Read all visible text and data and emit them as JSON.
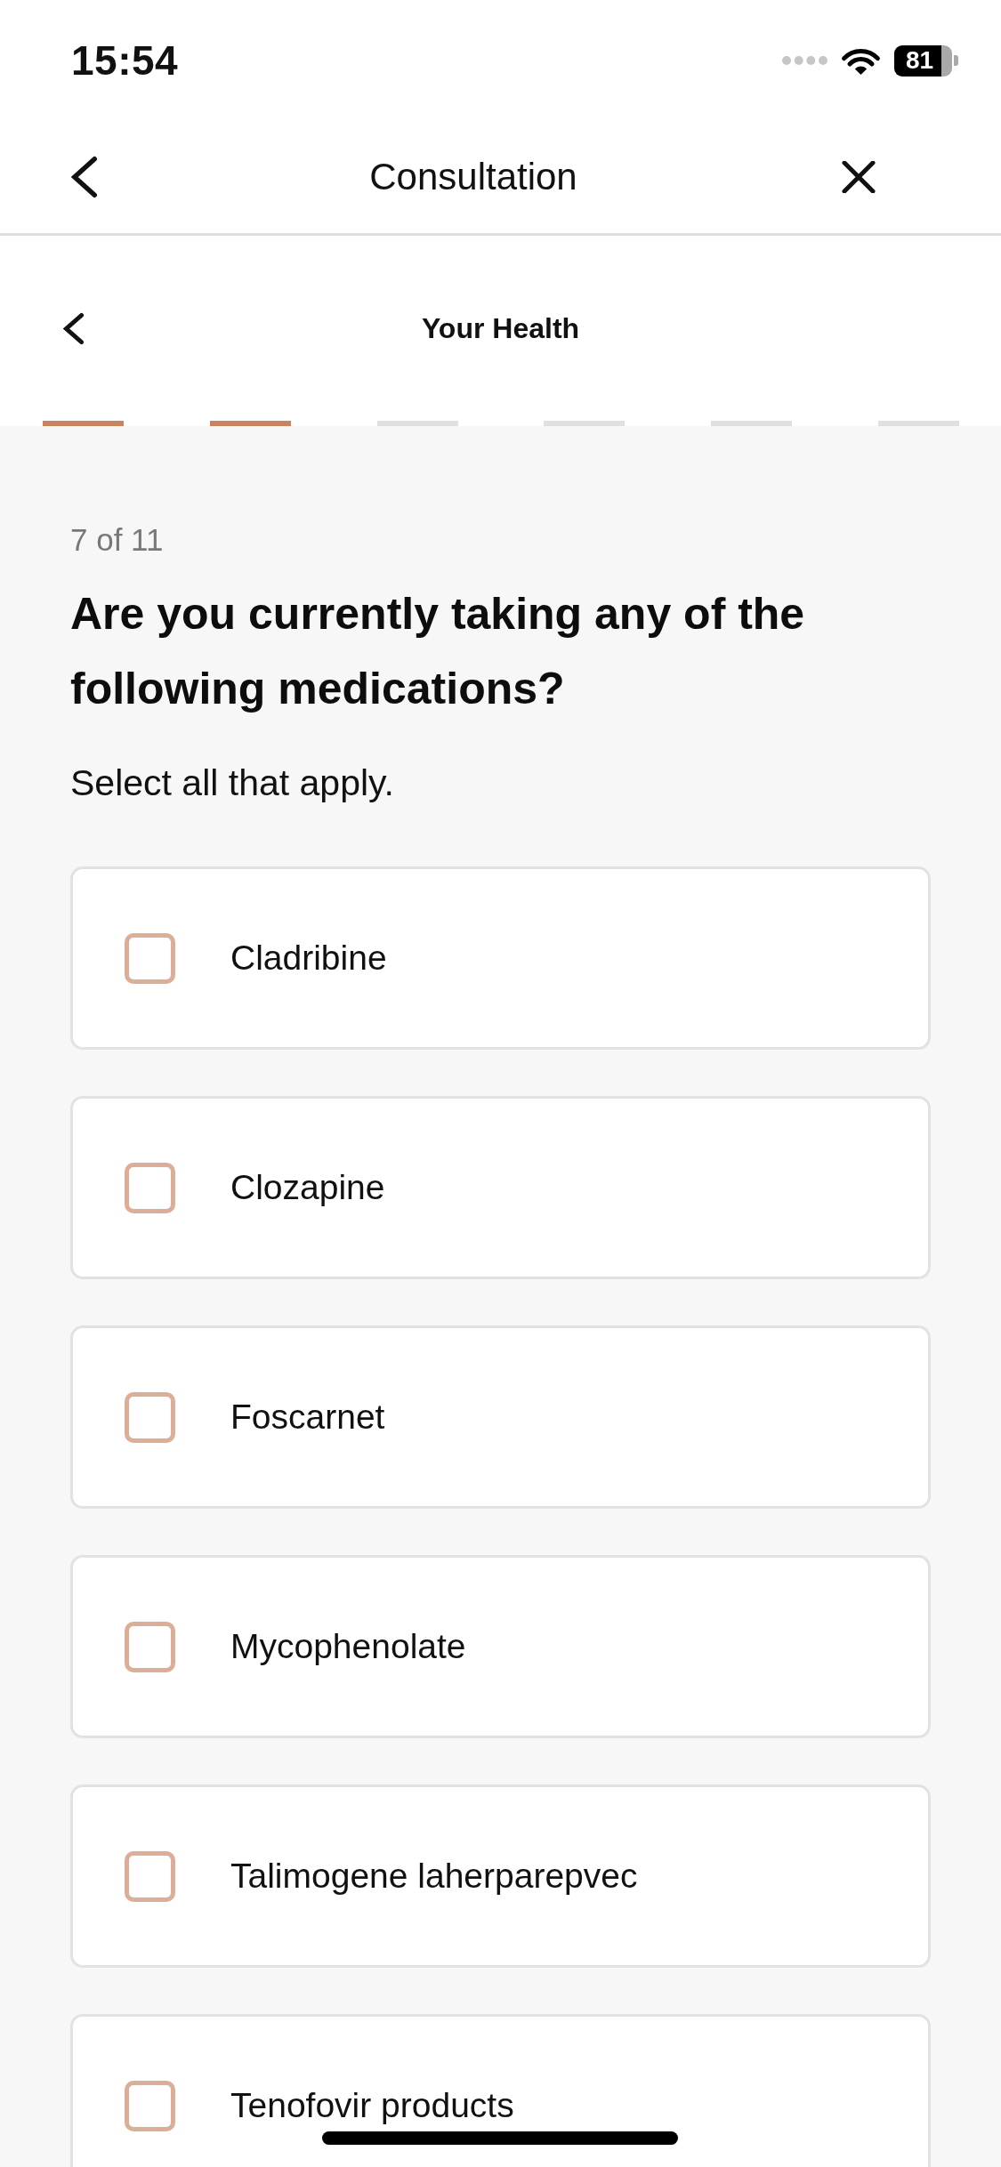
{
  "status_bar": {
    "time": "15:54",
    "battery": "81"
  },
  "nav_bar": {
    "title": "Consultation"
  },
  "section_header": {
    "title": "Your Health"
  },
  "progress_steps": [
    {
      "complete": true
    },
    {
      "complete": true
    },
    {
      "complete": false
    },
    {
      "complete": false
    },
    {
      "complete": false
    },
    {
      "complete": false
    }
  ],
  "question": {
    "counter": "7 of 11",
    "text": "Are you currently taking any of the following medications?",
    "hint": "Select all that apply."
  },
  "options": [
    {
      "label": "Cladribine",
      "checked": false
    },
    {
      "label": "Clozapine",
      "checked": false
    },
    {
      "label": "Foscarnet",
      "checked": false
    },
    {
      "label": "Mycophenolate",
      "checked": false
    },
    {
      "label": "Talimogene laherparepvec",
      "checked": false
    },
    {
      "label": "Tenofovir products",
      "checked": false
    }
  ]
}
